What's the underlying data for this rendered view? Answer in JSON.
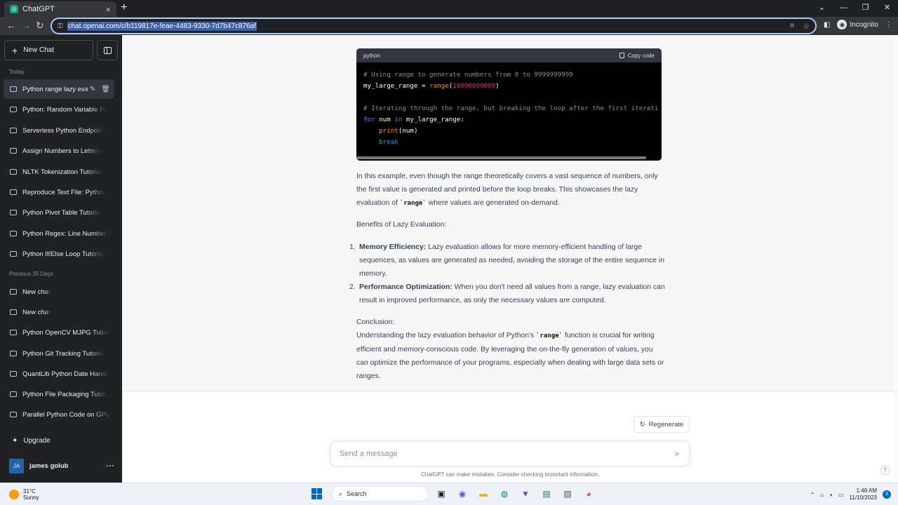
{
  "browser": {
    "tab_title": "ChatGPT",
    "url": "chat.openai.com/c/b119817e-feae-4483-9330-7d7b47c876af",
    "incognito_label": "Incognito"
  },
  "sidebar": {
    "new_chat": "New Chat",
    "today_title": "Today",
    "today_items": [
      "Python range lazy eval",
      "Python: Random Variable Pr",
      "Serverless Python Endpoint",
      "Assign Numbers to Letters",
      "NLTK Tokenization Tutorial",
      "Reproduce Text File: Python",
      "Python Pivot Table Tutorial",
      "Python Regex: Line Numbers",
      "Python If/Else Loop Tutorial"
    ],
    "prev_title": "Previous 30 Days",
    "prev_items": [
      "New chat",
      "New chat",
      "Python OpenCV MJPG Tutori",
      "Python Git Tracking Tutorial",
      "QuantLib Python Date Handli",
      "Python File Packaging Tutori",
      "Parallel Python Code on GPU"
    ],
    "upgrade": "Upgrade",
    "user_initials": "JA",
    "user_name": "james golub"
  },
  "code_block": {
    "language": "python",
    "copy_label": "Copy code",
    "line1": "# Using range to generate numbers from 0 to 9999999999",
    "line2_var": "my_large_range = ",
    "line2_fn": "range",
    "line2_num": "10000000000",
    "line4": "# Iterating through the range, but breaking the loop after the first iterati",
    "line5_for": "for",
    "line5_mid": " num ",
    "line5_in": "in",
    "line5_end": " my_large_range:",
    "line6_fn": "print",
    "line6_rest": "(num)",
    "line7": "break"
  },
  "answer": {
    "para1_a": "In this example, even though the range theoretically covers a vast sequence of numbers, only the first value is generated and printed before the loop breaks. This showcases the lazy evaluation of ",
    "para1_code": "`range`",
    "para1_b": " where values are generated on-demand.",
    "benefits_title": "Benefits of Lazy Evaluation:",
    "item1_num": "1.",
    "item1_bold": "Memory Efficiency:",
    "item1_text": " Lazy evaluation allows for more memory-efficient handling of large sequences, as values are generated as needed, avoiding the storage of the entire sequence in memory.",
    "item2_num": "2.",
    "item2_bold": "Performance Optimization:",
    "item2_text": " When you don't need all values from a range, lazy evaluation can result in improved performance, as only the necessary values are computed.",
    "conclusion_title": "Conclusion:",
    "conclusion_a": "Understanding the lazy evaluation behavior of Python's ",
    "conclusion_code": "`range`",
    "conclusion_b": " function is crucial for writing efficient and memory-conscious code. By leveraging the on-the-fly generation of values, you can optimize the performance of your programs, especially when dealing with large data sets or ranges."
  },
  "composer": {
    "regenerate": "Regenerate",
    "placeholder": "Send a message",
    "disclaimer": "ChatGPT can make mistakes. Consider checking important information.",
    "help": "?"
  },
  "taskbar": {
    "temp": "31°C",
    "condition": "Sunny",
    "search": "Search",
    "time": "1:48 AM",
    "date": "11/10/2023",
    "notifications": "3"
  }
}
